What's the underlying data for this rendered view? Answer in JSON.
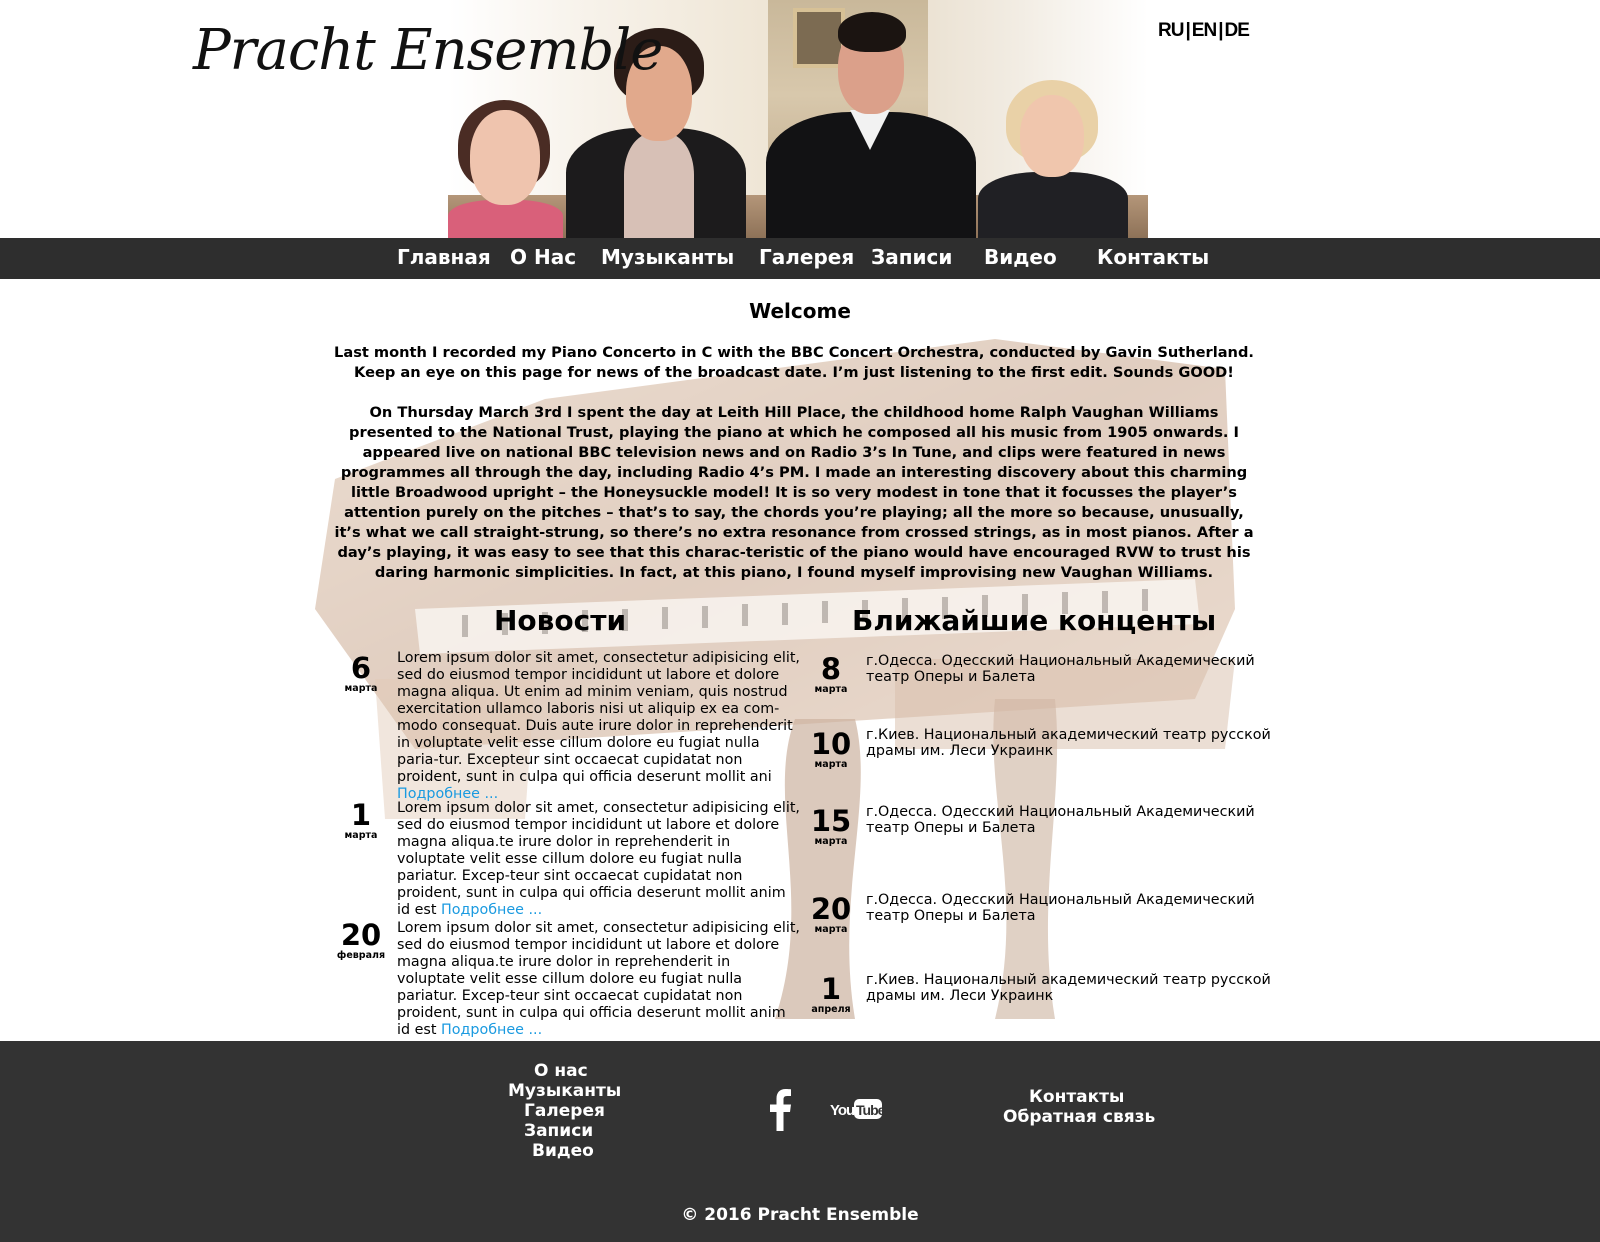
{
  "header": {
    "logo": "Pracht Ensemble",
    "languages": [
      "RU",
      "EN",
      "DE"
    ]
  },
  "nav": {
    "items": [
      "Главная",
      "О Нас",
      "Музыканты",
      "Галерея",
      "Записи",
      "Видео",
      "Контакты"
    ]
  },
  "welcome": {
    "title": "Welcome",
    "paragraph1": "Last month I recorded my Piano Concerto in C with the BBC Concert Orchestra, conducted by Gavin Sutherland. Keep an eye on this page for news of the broadcast date. I’m just listening to the first edit. Sounds GOOD!",
    "paragraph2": "On Thursday March 3rd I spent the day at Leith Hill Place, the childhood home Ralph Vaughan Williams presented to the National Trust, playing the piano at which he composed all his music from 1905 onwards. I appeared live on national BBC television news and on Radio 3’s In Tune, and clips were featured in news programmes all through the day, including Radio 4’s PM. I made an interesting discovery about this charming little Broadwood upright – the Honeysuckle model! It is so very modest in tone that it focusses the player’s attention purely on the pitches – that’s to say, the chords you’re playing; all the more so because, unusually, it’s what we call straight-strung, so there’s no extra resonance from crossed strings, as in most pianos. After a day’s playing, it was easy to see that this charac-teristic of the piano would have encouraged RVW to trust his daring harmonic simplicities. In fact, at this piano, I found myself improvising new Vaughan Williams."
  },
  "news": {
    "title": "Новости",
    "more_label": "Подробнее ...",
    "items": [
      {
        "day": "6",
        "month": "марта",
        "text": "Lorem ipsum dolor sit amet, consectetur adipisicing elit, sed do eiusmod tempor incididunt ut labore et dolore magna aliqua. Ut enim ad minim veniam, quis nostrud exercitation ullamco laboris nisi ut aliquip ex ea com-modo consequat. Duis aute irure dolor in reprehenderit in voluptate velit esse cillum dolore eu fugiat nulla paria-tur. Excepteur sint occaecat cupidatat non proident, sunt in culpa qui officia deserunt mollit ani"
      },
      {
        "day": "1",
        "month": "марта",
        "text": "Lorem ipsum dolor sit amet, consectetur adipisicing elit, sed do eiusmod tempor incididunt ut labore et dolore magna aliqua.te irure dolor in reprehenderit in voluptate velit esse cillum dolore eu fugiat nulla pariatur. Excep-teur sint occaecat cupidatat non proident, sunt in culpa qui officia deserunt mollit anim id est"
      },
      {
        "day": "20",
        "month": "февраля",
        "text": "Lorem ipsum dolor sit amet, consectetur adipisicing elit, sed do eiusmod tempor incididunt ut labore et dolore magna aliqua.te irure dolor in reprehenderit in voluptate velit esse cillum dolore eu fugiat nulla pariatur. Excep-teur sint occaecat cupidatat non proident, sunt in culpa qui officia deserunt mollit anim id est"
      }
    ]
  },
  "concerts": {
    "title": "Ближайшие конценты",
    "items": [
      {
        "day": "8",
        "month": "марта",
        "text": "г.Одесса.  Одесский Национальный Академический театр Оперы и Балета"
      },
      {
        "day": "10",
        "month": "марта",
        "text": "г.Киев.  Национальный академический театр русской драмы им. Леси Украинк"
      },
      {
        "day": "15",
        "month": "марта",
        "text": "г.Одесса.  Одесский Национальный Академический театр Оперы и Балета"
      },
      {
        "day": "20",
        "month": "марта",
        "text": "г.Одесса.  Одесский Национальный Академический театр Оперы и Балета"
      },
      {
        "day": "1",
        "month": "апреля",
        "text": "г.Киев.  Национальный академический театр русской драмы им. Леси Украинк"
      }
    ]
  },
  "footer": {
    "left_links": [
      "О нас",
      "Музыканты",
      "Галерея",
      "Записи",
      "Видео"
    ],
    "right_links": [
      "Контакты",
      "Обратная связь"
    ],
    "social": [
      "facebook-icon",
      "youtube-icon"
    ],
    "youtube_text": "YouTube",
    "copyright": "© 2016 Pracht Ensemble"
  },
  "colors": {
    "nav_bg": "#2e2e2e",
    "footer_bg": "#333333",
    "link": "#1a9ae0"
  }
}
